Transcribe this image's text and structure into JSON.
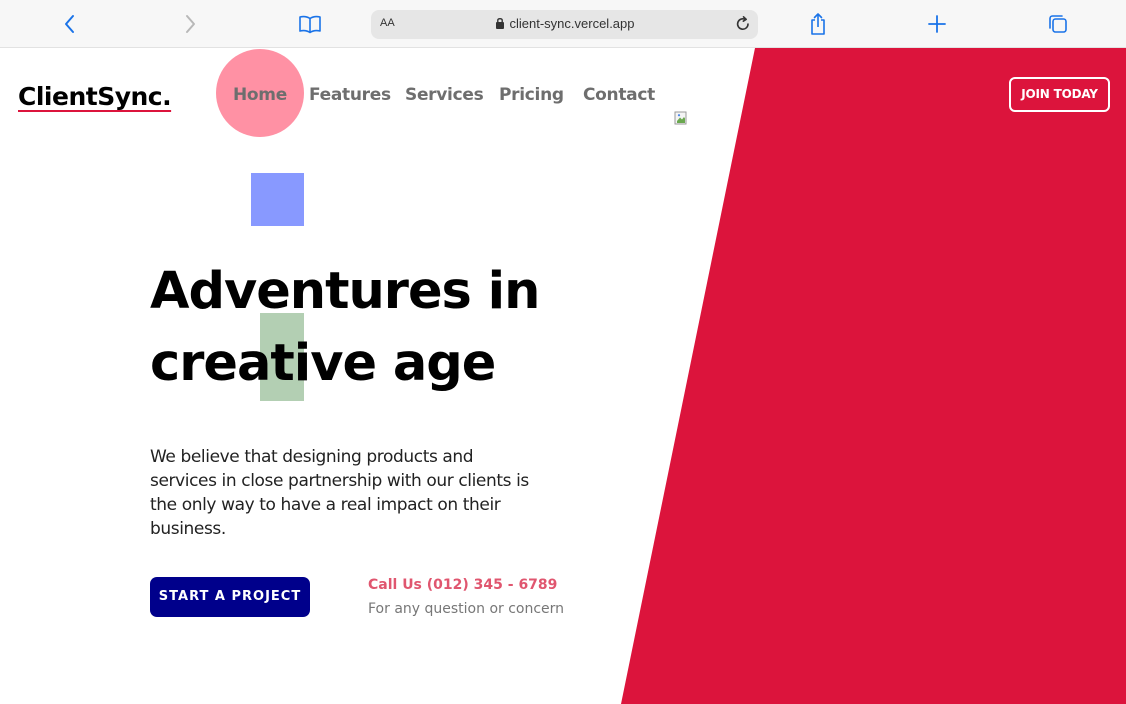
{
  "browser": {
    "address_aa": "AA",
    "url": "client-sync.vercel.app",
    "icons": [
      "back-icon",
      "forward-icon",
      "book-icon",
      "lock-icon",
      "reload-icon",
      "share-icon",
      "plus-icon",
      "tabs-icon"
    ]
  },
  "header": {
    "brand": "ClientSync.",
    "nav": [
      {
        "label": "Home"
      },
      {
        "label": "Features"
      },
      {
        "label": "Services"
      },
      {
        "label": "Pricing"
      },
      {
        "label": "Contact"
      }
    ],
    "join_label": "JOIN TODAY"
  },
  "hero": {
    "title_line1": "Adventures in",
    "title_line2": "creative age",
    "description": "We believe that designing products and services in close partnership with our clients is the only way to have a real impact on their business.",
    "cta_label": "START A PROJECT",
    "call_label": "Call Us (012) 345 - 6789",
    "call_note": "For any question or concern"
  },
  "colors": {
    "accent_red": "#dc143c",
    "cta_blue": "#00008b",
    "home_highlight": "#ff91a4",
    "decor_blue": "#8899ff",
    "decor_green": "#b3cfb3",
    "call_pink": "#e0566f",
    "browser_blue": "#1a73e8"
  }
}
